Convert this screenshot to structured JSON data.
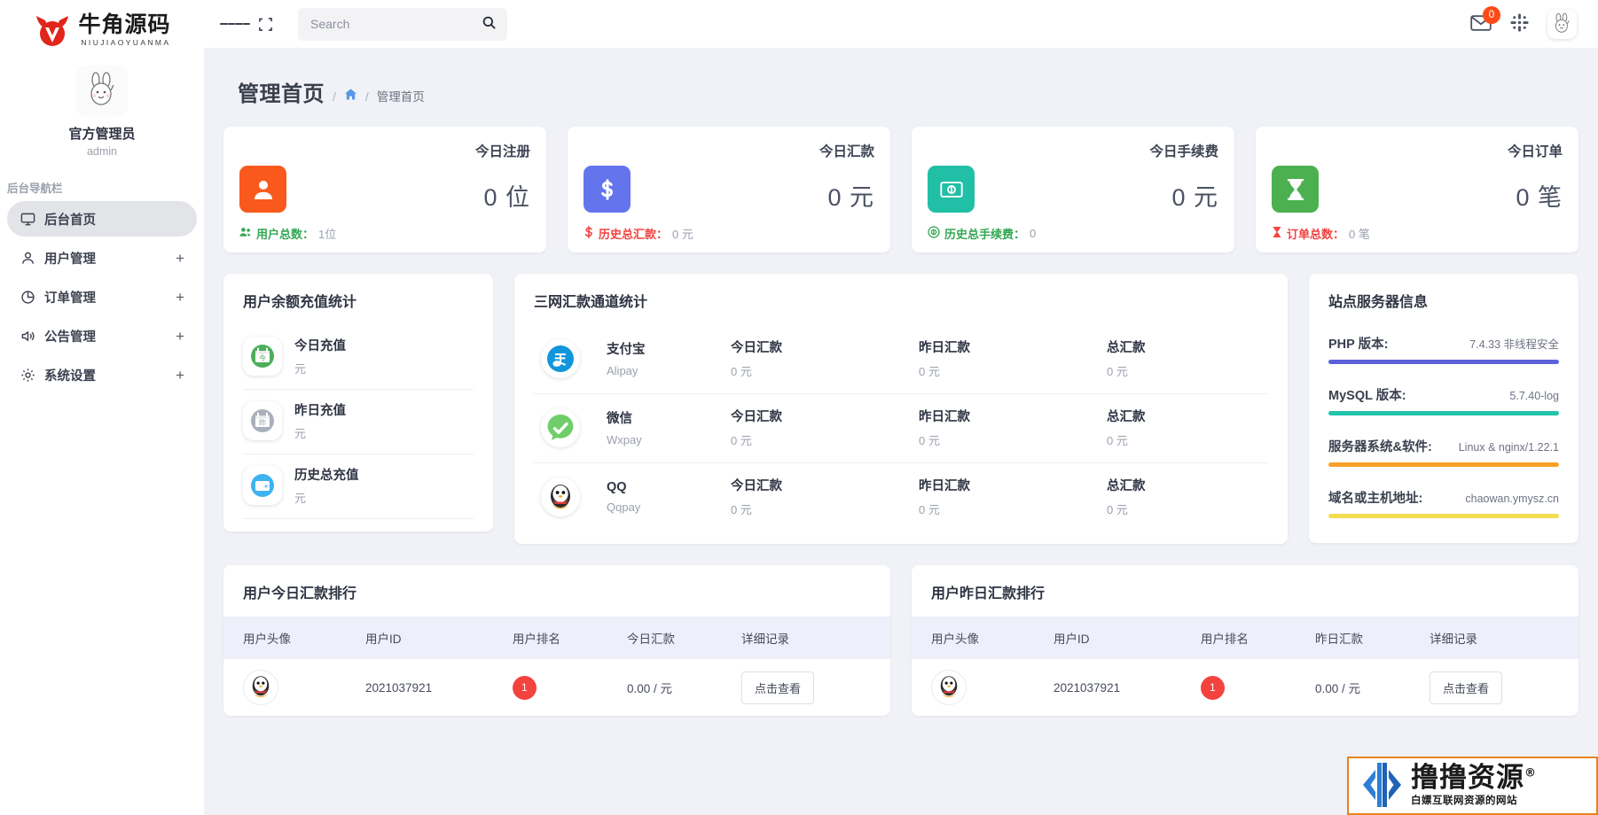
{
  "brand": {
    "cn": "牛角源码",
    "en": "NIUJIAOYUANMA"
  },
  "profile": {
    "name": "官方管理员",
    "account": "admin"
  },
  "sidebar": {
    "nav_title": "后台导航栏",
    "items": [
      {
        "label": "后台首页",
        "icon": "monitor-icon",
        "expandable": false,
        "active": true
      },
      {
        "label": "用户管理",
        "icon": "user-icon",
        "expandable": true,
        "active": false,
        "plus": "+"
      },
      {
        "label": "订单管理",
        "icon": "pie-chart-icon",
        "expandable": true,
        "active": false,
        "plus": "+"
      },
      {
        "label": "公告管理",
        "icon": "speaker-icon",
        "expandable": true,
        "active": false,
        "plus": "+"
      },
      {
        "label": "系统设置",
        "icon": "gear-icon",
        "expandable": true,
        "active": false,
        "plus": "+"
      }
    ]
  },
  "topbar": {
    "search_placeholder": "Search",
    "mail_badge": "0"
  },
  "page": {
    "title": "管理首页",
    "sep": "/",
    "crumb_home_icon": "home-icon",
    "crumb_current": "管理首页"
  },
  "stats": [
    {
      "label": "今日注册",
      "value": "0 位",
      "icon": "user-solid-icon",
      "color": "#f9591c",
      "foot_icon": "users-icon",
      "foot_label": "用户总数：",
      "foot_value": "1位",
      "foot_color": "#33a852"
    },
    {
      "label": "今日汇款",
      "value": "0 元",
      "icon": "dollar-icon",
      "color": "#6474ec",
      "foot_icon": "dollar-small-icon",
      "foot_label": "历史总汇款：",
      "foot_value": "0 元",
      "foot_color": "#f4433f"
    },
    {
      "label": "今日手续费",
      "value": "0 元",
      "icon": "money-bill-icon",
      "color": "#21bfa6",
      "foot_icon": "coin-icon",
      "foot_label": "历史总手续费：",
      "foot_value": "0",
      "foot_color": "#33a852"
    },
    {
      "label": "今日订单",
      "value": "0 笔",
      "icon": "hourglass-icon",
      "color": "#4cb050",
      "foot_icon": "hourglass-small-icon",
      "foot_label": "订单总数：",
      "foot_value": "0 笔",
      "foot_color": "#f4433f"
    }
  ],
  "recharge_panel": {
    "title": "用户余额充值统计",
    "rows": [
      {
        "title": "今日充值",
        "unit": "元",
        "icon": "calendar-today-icon",
        "color": "#4eae5b"
      },
      {
        "title": "昨日充值",
        "unit": "元",
        "icon": "calendar-yesterday-icon",
        "color": "#a9b0bb"
      },
      {
        "title": "历史总充值",
        "unit": "元",
        "icon": "wallet-icon",
        "color": "#3fb3ef"
      }
    ]
  },
  "channel_panel": {
    "title": "三网汇款通道统计",
    "columns": [
      "今日汇款",
      "昨日汇款",
      "总汇款"
    ],
    "rows": [
      {
        "name": "支付宝",
        "sub": "Alipay",
        "icon": "alipay-icon",
        "color": "#1296db",
        "today": "0 元",
        "yesterday": "0 元",
        "total": "0 元"
      },
      {
        "name": "微信",
        "sub": "Wxpay",
        "icon": "wechat-icon",
        "color": "#6fce6a",
        "today": "0 元",
        "yesterday": "0 元",
        "total": "0 元"
      },
      {
        "name": "QQ",
        "sub": "Qqpay",
        "icon": "qq-icon",
        "color": "#ffffff",
        "today": "0 元",
        "yesterday": "0 元",
        "total": "0 元"
      }
    ]
  },
  "server_panel": {
    "title": "站点服务器信息",
    "rows": [
      {
        "key": "PHP 版本:",
        "value": "7.4.33 非线程安全",
        "bar_color": "#5b62d8"
      },
      {
        "key": "MySQL 版本:",
        "value": "5.7.40-log",
        "bar_color": "#23c4ab"
      },
      {
        "key": "服务器系统&软件:",
        "value": "Linux & nginx/1.22.1",
        "bar_color": "#f7a028"
      },
      {
        "key": "域名或主机地址:",
        "value": "chaowan.ymysz.cn",
        "bar_color": "#f3dd50"
      }
    ]
  },
  "rank_today": {
    "title": "用户今日汇款排行",
    "columns": [
      "用户头像",
      "用户ID",
      "用户排名",
      "今日汇款",
      "详细记录"
    ],
    "rows": [
      {
        "avatar": "qq-avatar",
        "uid": "2021037921",
        "rank": "1",
        "amount": "0.00 / 元",
        "action": "点击查看"
      }
    ]
  },
  "rank_yesterday": {
    "title": "用户昨日汇款排行",
    "columns": [
      "用户头像",
      "用户ID",
      "用户排名",
      "昨日汇款",
      "详细记录"
    ],
    "rows": [
      {
        "avatar": "qq-avatar",
        "uid": "2021037921",
        "rank": "1",
        "amount": "0.00 / 元",
        "action": "点击查看"
      }
    ]
  },
  "watermark": {
    "cn": "撸撸资源",
    "reg": "®",
    "sub": "白嫖互联网资源的网站"
  }
}
